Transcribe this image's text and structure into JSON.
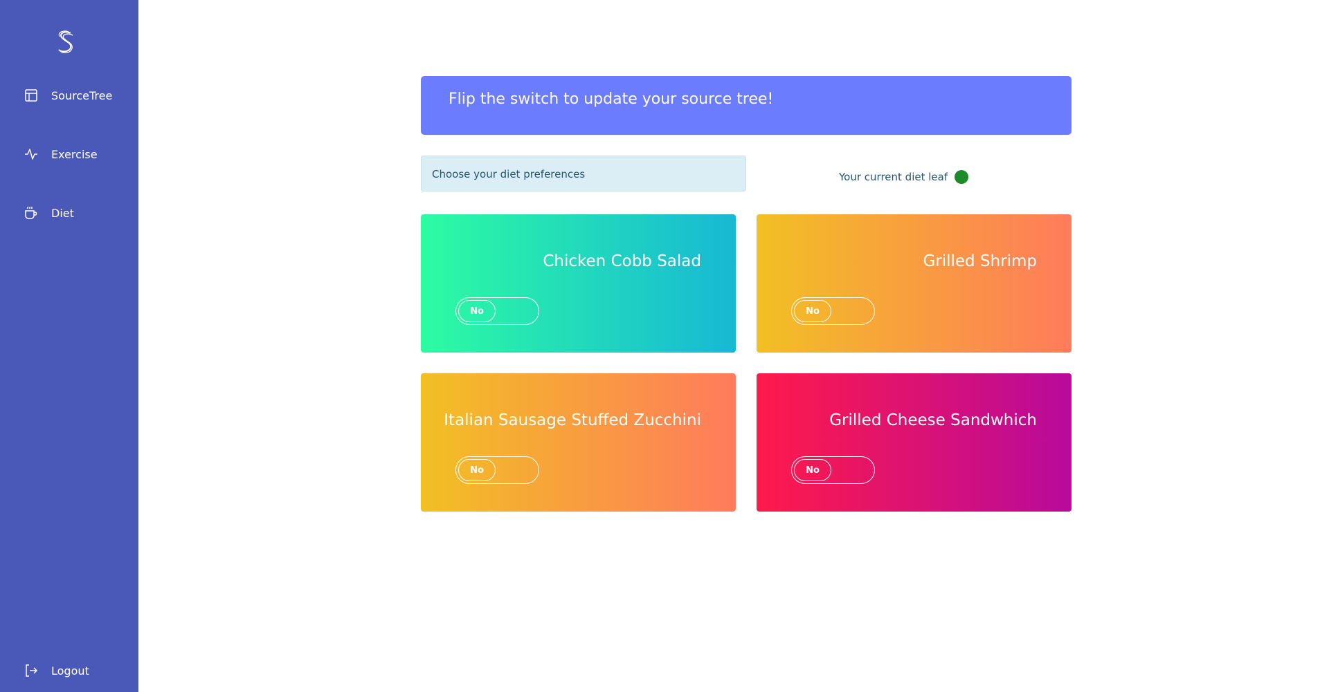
{
  "sidebar": {
    "logo_icon": "s-logo-icon",
    "items": [
      {
        "label": "SourceTree",
        "icon": "layout-icon"
      },
      {
        "label": "Exercise",
        "icon": "activity-icon"
      },
      {
        "label": "Diet",
        "icon": "coffee-icon"
      }
    ],
    "logout": {
      "label": "Logout",
      "icon": "logout-icon"
    }
  },
  "main": {
    "banner": "Flip the switch to update your source tree!",
    "preferences_label": "Choose your diet preferences",
    "leaf_status_label": "Your current diet leaf",
    "leaf_status_color": "#1e8b2a",
    "cards": [
      {
        "title": "Chicken Cobb Salad",
        "toggle": "No",
        "gradient": [
          "#2dfca2",
          "#17b8d4"
        ]
      },
      {
        "title": "Grilled Shrimp",
        "toggle": "No",
        "gradient": [
          "#f2c023",
          "#ff7b5c"
        ]
      },
      {
        "title": "Italian Sausage Stuffed Zucchini",
        "toggle": "No",
        "gradient": [
          "#f2c023",
          "#ff7b5c"
        ]
      },
      {
        "title": "Grilled Cheese Sandwhich",
        "toggle": "No",
        "gradient": [
          "#ff1a4a",
          "#b80a9c"
        ]
      }
    ]
  },
  "colors": {
    "sidebar_bg": "#4a58b8",
    "banner_bg": "#6b7cfe",
    "pref_box_bg": "#dbeef5"
  }
}
